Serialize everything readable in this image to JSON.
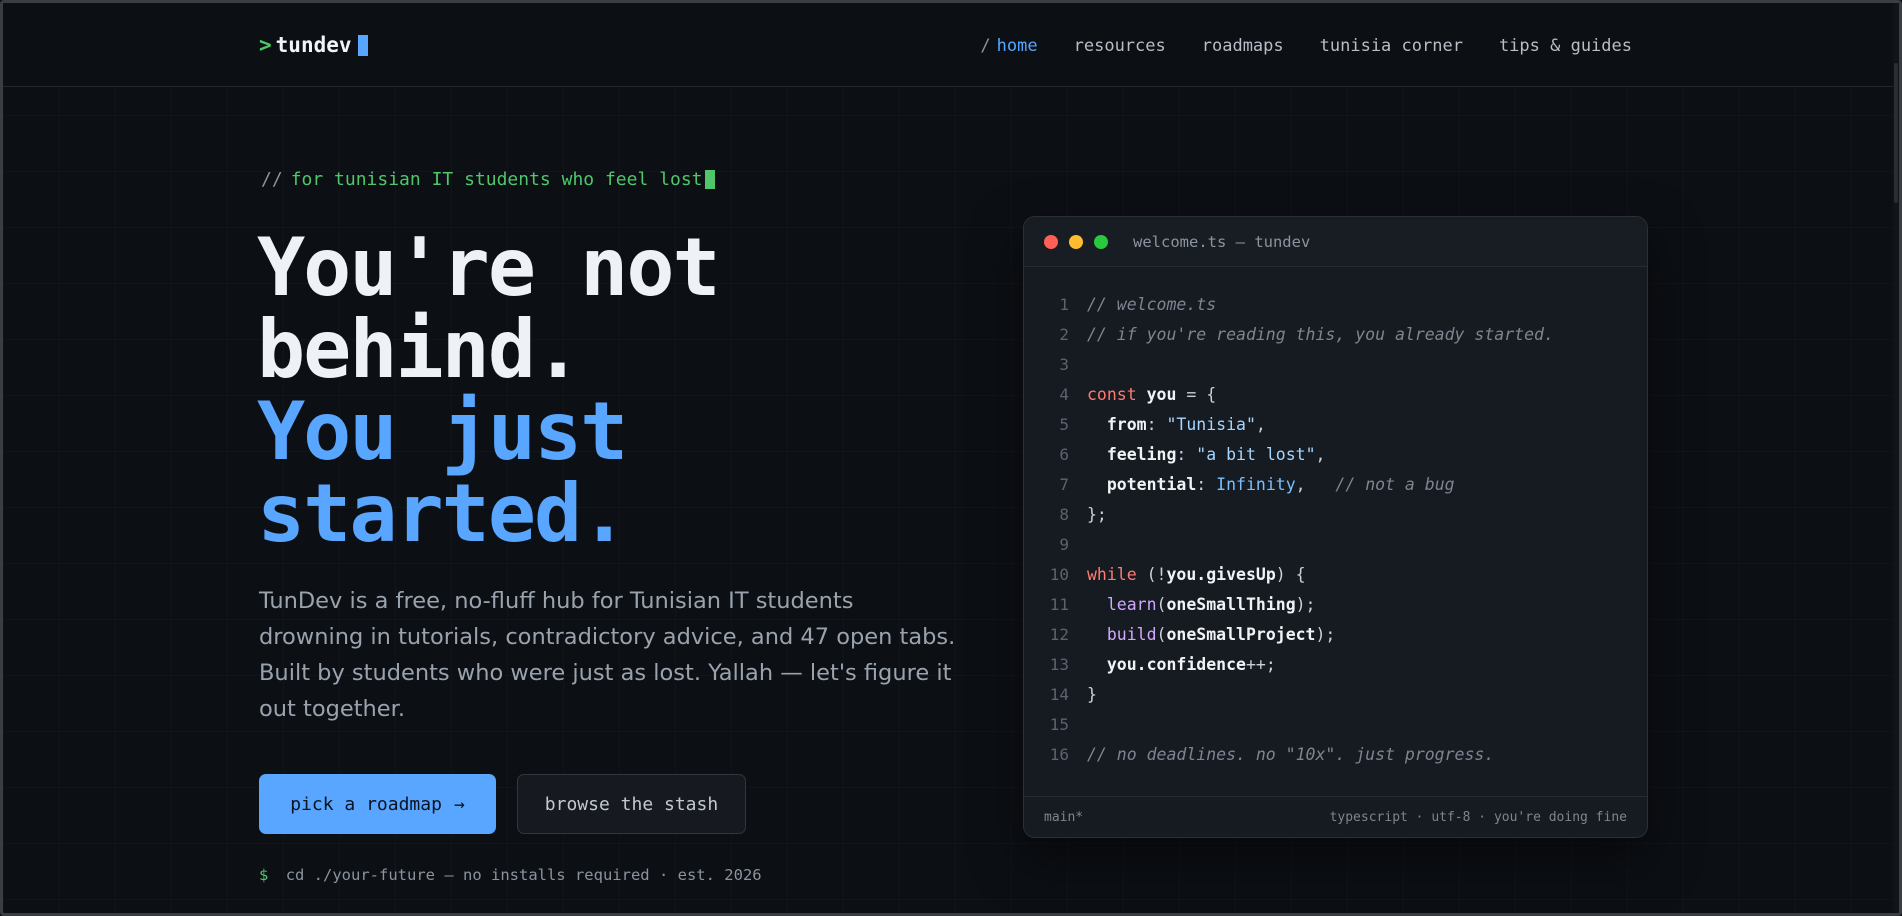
{
  "header": {
    "logo_prompt": ">",
    "logo_name": "tundev",
    "nav": [
      {
        "slash": "/",
        "label": "home",
        "active": true
      },
      {
        "label": "resources"
      },
      {
        "label": "roadmaps"
      },
      {
        "label": "tunisia corner"
      },
      {
        "label": "tips & guides"
      }
    ]
  },
  "hero": {
    "tagline_comment": "//",
    "tagline": "for tunisian IT students who feel lost",
    "headline_1a": "You're not",
    "headline_1b": "behind.",
    "headline_2a": "You just",
    "headline_2b": "started.",
    "description": "TunDev is a free, no-fluff hub for Tunisian IT students drowning in tutorials, contradictory advice, and 47 open tabs. Built by students who were just as lost. Yallah — let's figure it out together.",
    "primary_button": "pick a roadmap",
    "primary_arrow": "→",
    "secondary_button": "browse the stash",
    "footline_prompt": "$",
    "footline": "cd ./your-future — no installs required · est. 2026"
  },
  "editor": {
    "title": "welcome.ts — tundev",
    "status_left": "main*",
    "status_right": "typescript · utf-8 · you're doing fine",
    "lines": [
      {
        "n": "1",
        "tokens": [
          {
            "t": "// welcome.ts",
            "c": "comment"
          }
        ]
      },
      {
        "n": "2",
        "tokens": [
          {
            "t": "// if you're reading this, you already started.",
            "c": "comment"
          }
        ]
      },
      {
        "n": "3",
        "tokens": []
      },
      {
        "n": "4",
        "tokens": [
          {
            "t": "const",
            "c": "kw"
          },
          {
            "t": " ",
            "c": "p"
          },
          {
            "t": "you",
            "c": "var"
          },
          {
            "t": " = {",
            "c": "p"
          }
        ]
      },
      {
        "n": "5",
        "tokens": [
          {
            "t": "  ",
            "c": "p"
          },
          {
            "t": "from",
            "c": "var"
          },
          {
            "t": ": ",
            "c": "p"
          },
          {
            "t": "\"Tunisia\"",
            "c": "str"
          },
          {
            "t": ",",
            "c": "p"
          }
        ]
      },
      {
        "n": "6",
        "tokens": [
          {
            "t": "  ",
            "c": "p"
          },
          {
            "t": "feeling",
            "c": "var"
          },
          {
            "t": ": ",
            "c": "p"
          },
          {
            "t": "\"a bit lost\"",
            "c": "str"
          },
          {
            "t": ",",
            "c": "p"
          }
        ]
      },
      {
        "n": "7",
        "tokens": [
          {
            "t": "  ",
            "c": "p"
          },
          {
            "t": "potential",
            "c": "var"
          },
          {
            "t": ": ",
            "c": "p"
          },
          {
            "t": "Infinity",
            "c": "num"
          },
          {
            "t": ",   ",
            "c": "p"
          },
          {
            "t": "// not a bug",
            "c": "comment"
          }
        ]
      },
      {
        "n": "8",
        "tokens": [
          {
            "t": "};",
            "c": "p"
          }
        ]
      },
      {
        "n": "9",
        "tokens": []
      },
      {
        "n": "10",
        "tokens": [
          {
            "t": "while",
            "c": "kw"
          },
          {
            "t": " (!",
            "c": "p"
          },
          {
            "t": "you.givesUp",
            "c": "var"
          },
          {
            "t": ") {",
            "c": "p"
          }
        ]
      },
      {
        "n": "11",
        "tokens": [
          {
            "t": "  ",
            "c": "p"
          },
          {
            "t": "learn",
            "c": "fn"
          },
          {
            "t": "(",
            "c": "p"
          },
          {
            "t": "oneSmallThing",
            "c": "var"
          },
          {
            "t": ");",
            "c": "p"
          }
        ]
      },
      {
        "n": "12",
        "tokens": [
          {
            "t": "  ",
            "c": "p"
          },
          {
            "t": "build",
            "c": "fn"
          },
          {
            "t": "(",
            "c": "p"
          },
          {
            "t": "oneSmallProject",
            "c": "var"
          },
          {
            "t": ");",
            "c": "p"
          }
        ]
      },
      {
        "n": "13",
        "tokens": [
          {
            "t": "  ",
            "c": "p"
          },
          {
            "t": "you.confidence",
            "c": "var"
          },
          {
            "t": "++;",
            "c": "p"
          }
        ]
      },
      {
        "n": "14",
        "tokens": [
          {
            "t": "}",
            "c": "p"
          }
        ]
      },
      {
        "n": "15",
        "tokens": []
      },
      {
        "n": "16",
        "tokens": [
          {
            "t": "// no deadlines. no \"10x\". just progress.",
            "c": "comment"
          }
        ]
      }
    ]
  },
  "colors": {
    "accent": "#58a6ff",
    "green": "#4fc66a",
    "background": "#0c0f14"
  }
}
